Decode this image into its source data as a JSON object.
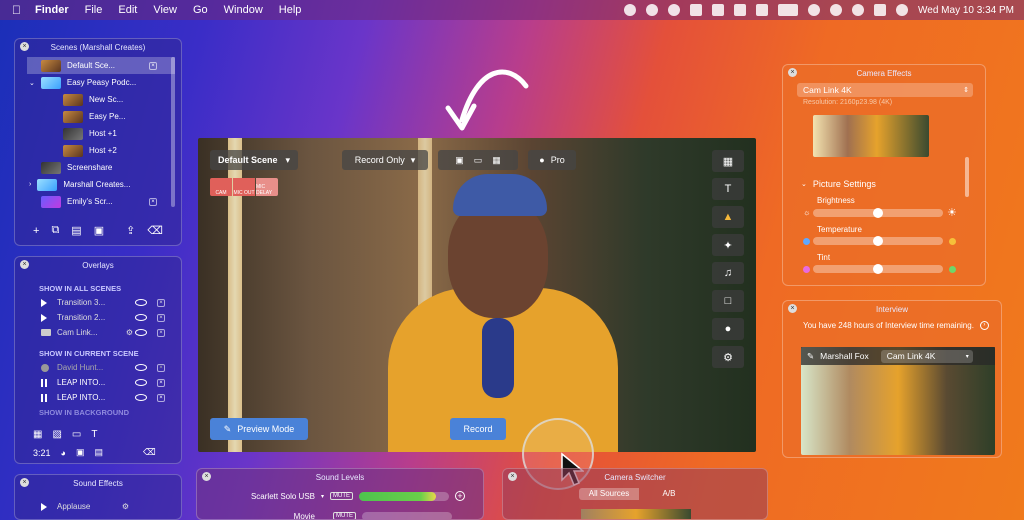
{
  "menubar": {
    "app": "Finder",
    "items": [
      "File",
      "Edit",
      "View",
      "Go",
      "Window",
      "Help"
    ],
    "clock": "Wed May 10  3:34 PM"
  },
  "scenes": {
    "title": "Scenes (Marshall Creates)",
    "items": [
      {
        "label": "Default Sce..."
      },
      {
        "label": "Easy Peasy Podc..."
      },
      {
        "label": "New Sc..."
      },
      {
        "label": "Easy Pe..."
      },
      {
        "label": "Host +1"
      },
      {
        "label": "Host +2"
      },
      {
        "label": "Screenshare"
      },
      {
        "label": "Marshall Creates..."
      },
      {
        "label": "Emily's Scr..."
      }
    ]
  },
  "overlays": {
    "title": "Overlays",
    "all_heading": "SHOW IN ALL SCENES",
    "all_items": [
      "Transition 3...",
      "Transition 2...",
      "Cam Link..."
    ],
    "current_heading": "SHOW IN CURRENT SCENE",
    "current_items": [
      "David Hunt...",
      "LEAP INTO...",
      "LEAP INTO..."
    ],
    "background_heading": "SHOW IN BACKGROUND",
    "time_label": "3:21"
  },
  "sound_effects": {
    "title": "Sound Effects",
    "items": [
      "Applause"
    ]
  },
  "video": {
    "scene_dropdown": "Default Scene",
    "mode_dropdown": "Record Only",
    "pro_label": "Pro",
    "badges": [
      "CAM",
      "MIC OUT",
      "MIC DELAY"
    ],
    "preview_label": "Preview Mode",
    "record_label": "Record"
  },
  "camera_effects": {
    "title": "Camera Effects",
    "device": "Cam Link 4K",
    "resolution": "Resolution: 2160p23.98 (4K)",
    "section": "Picture Settings",
    "brightness": "Brightness",
    "temperature": "Temperature",
    "tint": "Tint",
    "brightness_level": 0.5,
    "temperature_level": 0.5,
    "tint_level": 0.5
  },
  "interview": {
    "title": "Interview",
    "notice": "You have 248 hours of Interview time remaining.",
    "guest": "Marshall Fox",
    "device": "Cam Link 4K"
  },
  "sound_levels": {
    "title": "Sound Levels",
    "sources": [
      {
        "name": "Scarlett Solo USB",
        "mute": "MUTE",
        "level": 0.85
      },
      {
        "name": "Movie",
        "mute": "MUTE",
        "level": 0.0
      }
    ]
  },
  "camera_switcher": {
    "title": "Camera Switcher",
    "tabs": [
      "All Sources",
      "A/B"
    ]
  }
}
